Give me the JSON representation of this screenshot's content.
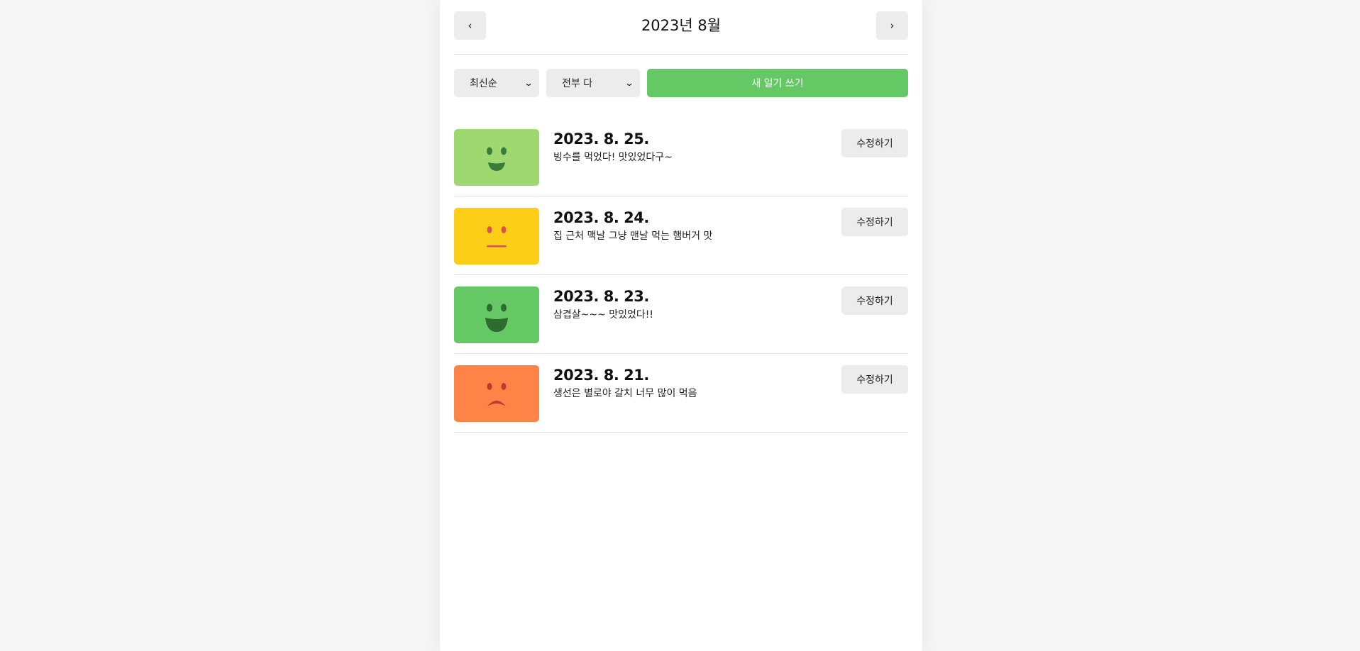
{
  "header": {
    "title": "2023년 8월",
    "prev_label": "‹",
    "next_label": "›"
  },
  "toolbar": {
    "sort_selected": "최신순",
    "filter_selected": "전부 다",
    "new_button_label": "새 일기 쓰기"
  },
  "diary_items": [
    {
      "date": "2023. 8. 25.",
      "content": "빙수를 먹었다! 맛있었다구~",
      "emotion_icon": "smile-face-icon",
      "emotion_color": "#9fd871",
      "edit_label": "수정하기"
    },
    {
      "date": "2023. 8. 24.",
      "content": "집 근처 맥날 그냥 맨날 먹는 햄버거 맛",
      "emotion_icon": "neutral-face-icon",
      "emotion_color": "#fdce17",
      "edit_label": "수정하기"
    },
    {
      "date": "2023. 8. 23.",
      "content": "삼겹살~~~ 맛있었다!!",
      "emotion_icon": "big-smile-face-icon",
      "emotion_color": "#64c964",
      "edit_label": "수정하기"
    },
    {
      "date": "2023. 8. 21.",
      "content": "생선은 별로야 갈치 너무 많이 먹음",
      "emotion_icon": "sad-face-icon",
      "emotion_color": "#fd8446",
      "edit_label": "수정하기"
    }
  ],
  "colors": {
    "accent_green": "#64c964",
    "button_gray": "#ececec",
    "background": "#f6f6f6"
  }
}
